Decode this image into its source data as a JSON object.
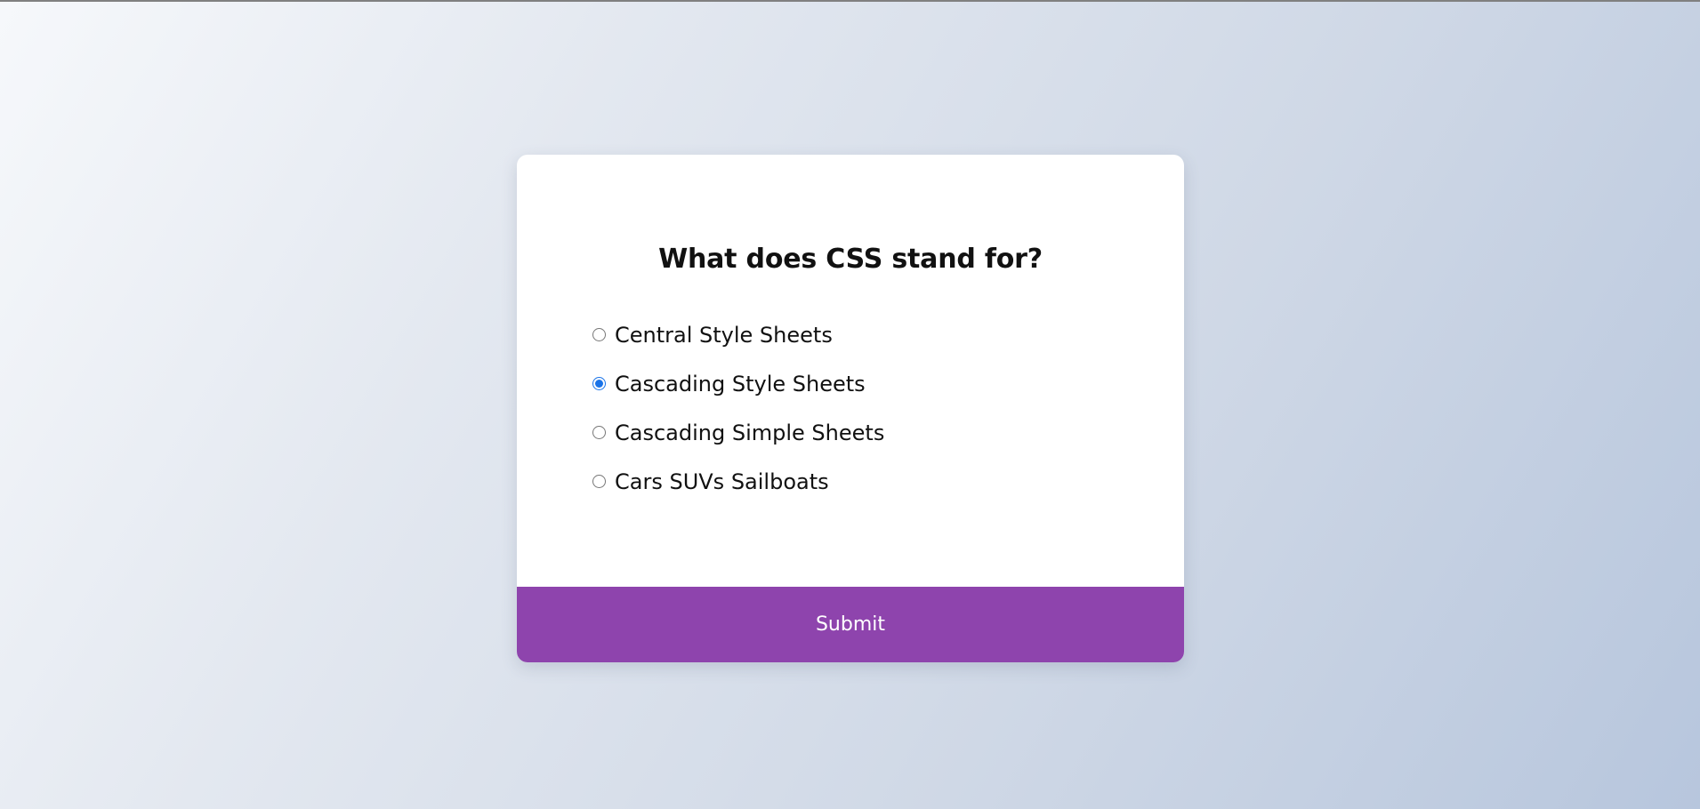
{
  "quiz": {
    "question": "What does CSS stand for?",
    "answers": [
      {
        "id": "a",
        "label": "Central Style Sheets",
        "checked": false
      },
      {
        "id": "b",
        "label": "Cascading Style Sheets",
        "checked": true
      },
      {
        "id": "c",
        "label": "Cascading Simple Sheets",
        "checked": false
      },
      {
        "id": "d",
        "label": "Cars SUVs Sailboats",
        "checked": false
      }
    ],
    "submit_label": "Submit"
  },
  "colors": {
    "accent": "#8e44ad",
    "radio_selected": "#1a73e8",
    "card_background": "#ffffff"
  }
}
